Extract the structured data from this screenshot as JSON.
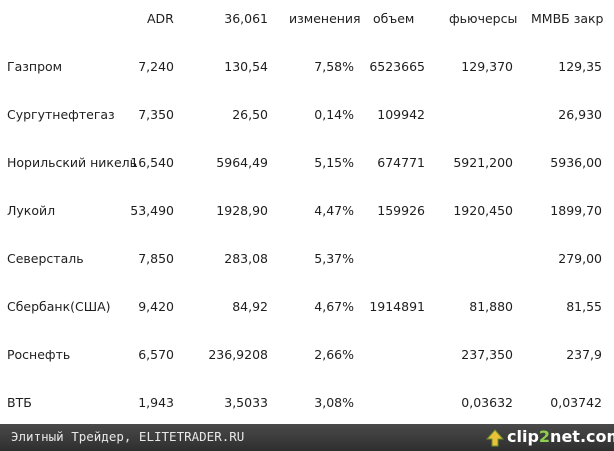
{
  "table": {
    "headers": [
      "ADR",
      "36,061",
      "изменения",
      "объем",
      "фьючерсы",
      "ММВБ закр"
    ],
    "rows": [
      {
        "name": "Газпром",
        "adr": "7,240",
        "val": "130,54",
        "change": "7,58%",
        "volume": "6523665",
        "futures": "129,370",
        "micex": "129,35"
      },
      {
        "name": "Сургутнефтегаз",
        "adr": "7,350",
        "val": "26,50",
        "change": "0,14%",
        "volume": "109942",
        "futures": "",
        "micex": "26,930"
      },
      {
        "name": "Норильский никель",
        "adr": "16,540",
        "val": "5964,49",
        "change": "5,15%",
        "volume": "674771",
        "futures": "5921,200",
        "micex": "5936,00"
      },
      {
        "name": "Лукойл",
        "adr": "53,490",
        "val": "1928,90",
        "change": "4,47%",
        "volume": "159926",
        "futures": "1920,450",
        "micex": "1899,70"
      },
      {
        "name": "Северсталь",
        "adr": "7,850",
        "val": "283,08",
        "change": "5,37%",
        "volume": "",
        "futures": "",
        "micex": "279,00"
      },
      {
        "name": "Сбербанк(США)",
        "adr": "9,420",
        "val": "84,92",
        "change": "4,67%",
        "volume": "1914891",
        "futures": "81,880",
        "micex": "81,55"
      },
      {
        "name": "Роснефть",
        "adr": "6,570",
        "val": "236,9208",
        "change": "2,66%",
        "volume": "",
        "futures": "237,350",
        "micex": "237,9"
      },
      {
        "name": "ВТБ",
        "adr": "1,943",
        "val": "3,5033",
        "change": "3,08%",
        "volume": "",
        "futures": "0,03632",
        "micex": "0,03742"
      }
    ]
  },
  "footer": {
    "caption": "Элитный Трейдер, ELITETRADER.RU",
    "logo_main": "clip",
    "logo_accent": "2",
    "logo_tail": "net.com",
    "logo_icon": "upload-arrow-icon"
  }
}
